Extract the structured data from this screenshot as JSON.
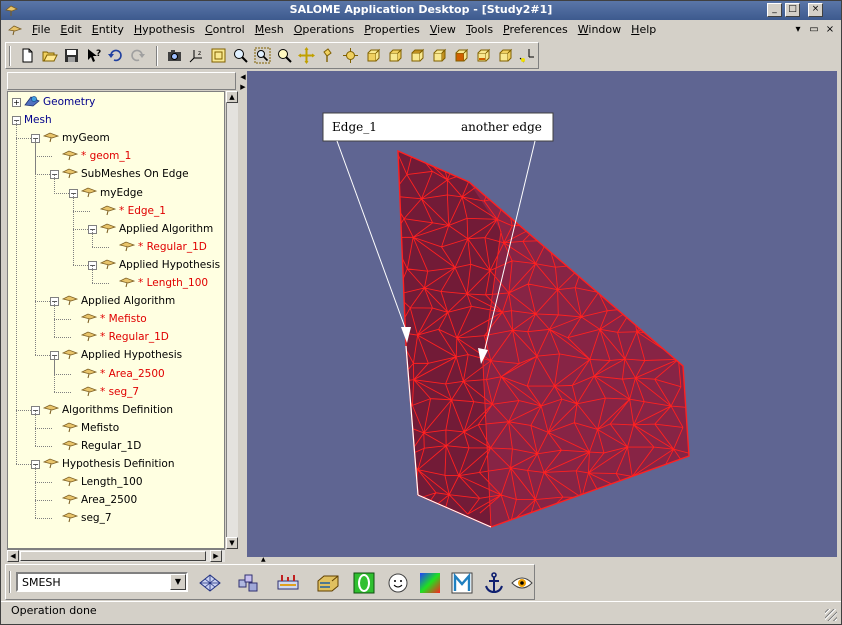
{
  "window": {
    "title": "SALOME Application Desktop - [Study2#1]",
    "controls": {
      "minimize": "_",
      "maximize": "□",
      "close": "×"
    }
  },
  "menu": {
    "items": [
      "File",
      "Edit",
      "Entity",
      "Hypothesis",
      "Control",
      "Mesh",
      "Operations",
      "Properties",
      "View",
      "Tools",
      "Preferences",
      "Window",
      "Help"
    ],
    "mdi_controls": {
      "minimize": "▾",
      "restore": "▭",
      "close": "×"
    }
  },
  "toolbar": {
    "icons": [
      "new-icon",
      "open-icon",
      "save-icon",
      "whats-this-icon",
      "undo-icon",
      "redo-icon",
      "camera-icon",
      "trihedron-icon",
      "fit-all-icon",
      "fit-area-icon",
      "zoom-icon",
      "pan-icon",
      "global-pan-icon",
      "rotate-icon",
      "front-view-icon",
      "back-view-icon",
      "top-view-icon",
      "bottom-view-icon",
      "left-view-icon",
      "right-view-icon",
      "reset-view-icon"
    ]
  },
  "tree": {
    "nodes": [
      {
        "label": "Geometry",
        "level": 0,
        "expander": "+",
        "color": "blue",
        "icon": "geometry-icon"
      },
      {
        "label": "Mesh",
        "level": 0,
        "expander": "-",
        "color": "blue",
        "icon": ""
      },
      {
        "label": "myGeom",
        "level": 1,
        "expander": "-",
        "color": "black",
        "icon": "mesh-node-icon"
      },
      {
        "label": "* geom_1",
        "level": 2,
        "expander": "",
        "color": "red",
        "icon": "mesh-node-icon"
      },
      {
        "label": "SubMeshes On Edge",
        "level": 2,
        "expander": "-",
        "color": "black",
        "icon": "mesh-node-icon"
      },
      {
        "label": "myEdge",
        "level": 3,
        "expander": "-",
        "color": "black",
        "icon": "mesh-node-icon"
      },
      {
        "label": "* Edge_1",
        "level": 4,
        "expander": "",
        "color": "red",
        "icon": "mesh-node-icon"
      },
      {
        "label": "Applied Algorithm",
        "level": 4,
        "expander": "-",
        "color": "black",
        "icon": "mesh-node-icon"
      },
      {
        "label": "* Regular_1D",
        "level": 5,
        "expander": "",
        "color": "red",
        "icon": "mesh-node-icon"
      },
      {
        "label": "Applied Hypothesis",
        "level": 4,
        "expander": "-",
        "color": "black",
        "icon": "mesh-node-icon"
      },
      {
        "label": "* Length_100",
        "level": 5,
        "expander": "",
        "color": "red",
        "icon": "mesh-node-icon"
      },
      {
        "label": "Applied Algorithm",
        "level": 2,
        "expander": "-",
        "color": "black",
        "icon": "mesh-node-icon"
      },
      {
        "label": "* Mefisto",
        "level": 3,
        "expander": "",
        "color": "red",
        "icon": "mesh-node-icon"
      },
      {
        "label": "* Regular_1D",
        "level": 3,
        "expander": "",
        "color": "red",
        "icon": "mesh-node-icon"
      },
      {
        "label": "Applied Hypothesis",
        "level": 2,
        "expander": "-",
        "color": "black",
        "icon": "mesh-node-icon"
      },
      {
        "label": "* Area_2500",
        "level": 3,
        "expander": "",
        "color": "red",
        "icon": "mesh-node-icon"
      },
      {
        "label": "* seg_7",
        "level": 3,
        "expander": "",
        "color": "red",
        "icon": "mesh-node-icon"
      },
      {
        "label": "Algorithms Definition",
        "level": 1,
        "expander": "-",
        "color": "black",
        "icon": "mesh-node-icon"
      },
      {
        "label": "Mefisto",
        "level": 2,
        "expander": "",
        "color": "black",
        "icon": "mesh-node-icon"
      },
      {
        "label": "Regular_1D",
        "level": 2,
        "expander": "",
        "color": "black",
        "icon": "mesh-node-icon"
      },
      {
        "label": "Hypothesis Definition",
        "level": 1,
        "expander": "-",
        "color": "black",
        "icon": "mesh-node-icon"
      },
      {
        "label": "Length_100",
        "level": 2,
        "expander": "",
        "color": "black",
        "icon": "mesh-node-icon"
      },
      {
        "label": "Area_2500",
        "level": 2,
        "expander": "",
        "color": "black",
        "icon": "mesh-node-icon"
      },
      {
        "label": "seg_7",
        "level": 2,
        "expander": "",
        "color": "black",
        "icon": "mesh-node-icon"
      }
    ]
  },
  "viewer": {
    "background_color": "#5f6592",
    "mesh_fill": "#8b1e3f",
    "mesh_edges": "#ff2020",
    "annotation": {
      "left_label": "Edge_1",
      "right_label": "another edge"
    }
  },
  "component": {
    "selected": "SMESH",
    "module_icons": [
      "mesh-module-icon",
      "build-module-icon",
      "hypothesis-module-icon",
      "compute-module-icon",
      "info-module-icon",
      "group-module-icon",
      "smiley-module-icon",
      "scalar-bar-icon",
      "measure-module-icon",
      "anchor-icon",
      "eye-icon"
    ]
  },
  "status": {
    "text": "Operation done"
  }
}
